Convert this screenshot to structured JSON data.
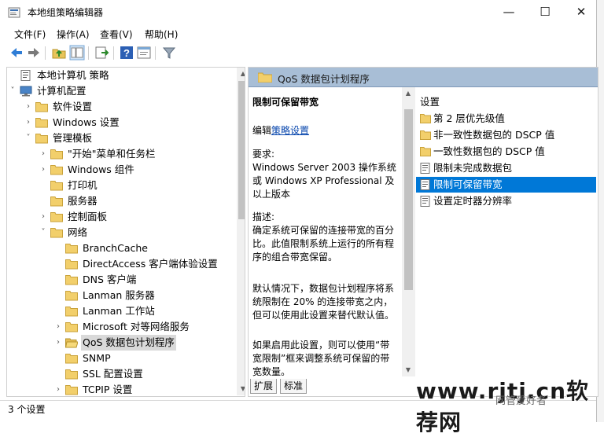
{
  "window": {
    "title": "本地组策略编辑器",
    "min_glyph": "—",
    "max_glyph": "☐",
    "close_glyph": "✕"
  },
  "menu": [
    "文件(F)",
    "操作(A)",
    "查看(V)",
    "帮助(H)"
  ],
  "toolbar": {
    "buttons": [
      "back-arrow-icon",
      "forward-arrow-icon",
      "up-folder-icon",
      "show-hide-tree-icon",
      "export-list-icon",
      "help-icon",
      "properties-icon",
      "filter-icon"
    ]
  },
  "tree": [
    {
      "label": "本地计算机 策略",
      "twisty": "",
      "icon": "computer-policy"
    },
    {
      "label": "计算机配置",
      "twisty": "˅",
      "icon": "computer"
    },
    {
      "label": "软件设置",
      "twisty": "›",
      "icon": "folder"
    },
    {
      "label": "Windows 设置",
      "twisty": "›",
      "icon": "folder"
    },
    {
      "label": "管理模板",
      "twisty": "˅",
      "icon": "folder"
    },
    {
      "label": "\"开始\"菜单和任务栏",
      "twisty": "›",
      "icon": "folder"
    },
    {
      "label": "Windows 组件",
      "twisty": "›",
      "icon": "folder"
    },
    {
      "label": "打印机",
      "twisty": "",
      "icon": "folder"
    },
    {
      "label": "服务器",
      "twisty": "",
      "icon": "folder"
    },
    {
      "label": "控制面板",
      "twisty": "›",
      "icon": "folder"
    },
    {
      "label": "网络",
      "twisty": "˅",
      "icon": "folder"
    },
    {
      "label": "BranchCache",
      "twisty": "",
      "icon": "folder"
    },
    {
      "label": "DirectAccess 客户端体验设置",
      "twisty": "",
      "icon": "folder"
    },
    {
      "label": "DNS 客户端",
      "twisty": "",
      "icon": "folder"
    },
    {
      "label": "Lanman 服务器",
      "twisty": "",
      "icon": "folder"
    },
    {
      "label": "Lanman 工作站",
      "twisty": "",
      "icon": "folder"
    },
    {
      "label": "Microsoft 对等网络服务",
      "twisty": "›",
      "icon": "folder"
    },
    {
      "label": "QoS 数据包计划程序",
      "twisty": "›",
      "icon": "folder-open",
      "selected": true
    },
    {
      "label": "SNMP",
      "twisty": "",
      "icon": "folder"
    },
    {
      "label": "SSL 配置设置",
      "twisty": "",
      "icon": "folder"
    },
    {
      "label": "TCPIP 设置",
      "twisty": "›",
      "icon": "folder"
    }
  ],
  "right": {
    "header": "QoS 数据包计划程序",
    "desc_title": "限制可保留带宽",
    "edit_prefix": "编辑",
    "edit_link": "策略设置",
    "requirements": "要求:\nWindows Server 2003 操作系统或 Windows XP Professional 及以上版本",
    "description": "描述:\n确定系统可保留的连接带宽的百分比。此值限制系统上运行的所有程序的组合带宽保留。",
    "default": "默认情况下，数据包计划程序将系统限制在 20% 的连接带宽之内，但可以使用此设置来替代默认值。",
    "if_enabled": "如果启用此设置，则可以使用“带宽限制”框来调整系统可保留的带宽数量。",
    "settings_header": "设置",
    "settings": [
      {
        "label": "第 2 层优先级值",
        "icon": "folder"
      },
      {
        "label": "非一致性数据包的 DSCP 值",
        "icon": "folder"
      },
      {
        "label": "一致性数据包的 DSCP 值",
        "icon": "folder"
      },
      {
        "label": "限制未完成数据包",
        "icon": "setting"
      },
      {
        "label": "限制可保留带宽",
        "icon": "setting",
        "selected": true
      },
      {
        "label": "设置定时器分辨率",
        "icon": "setting"
      }
    ],
    "tabs": [
      "扩展",
      "标准"
    ]
  },
  "status": "3 个设置",
  "watermark": {
    "main": "www.rjtj.cn软荐网",
    "sub": "网管爱好者"
  }
}
